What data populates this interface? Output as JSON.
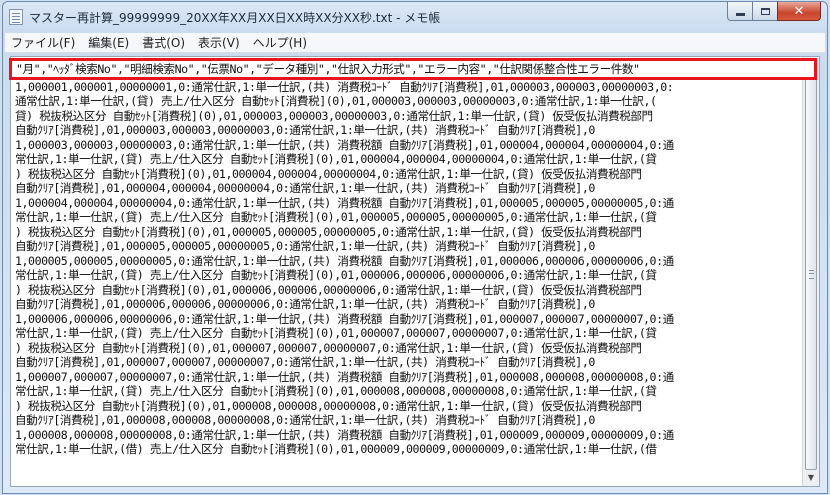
{
  "window": {
    "title": "マスター再計算_99999999_20XX年XX月XX日XX時XX分XX秒.txt - メモ帳",
    "icon": "notepad-icon",
    "buttons": {
      "minimize": "minimize-icon",
      "maximize": "maximize-icon",
      "close": "✕"
    }
  },
  "menu": {
    "items": [
      {
        "label": "ファイル(F)"
      },
      {
        "label": "編集(E)"
      },
      {
        "label": "書式(O)"
      },
      {
        "label": "表示(V)"
      },
      {
        "label": "ヘルプ(H)"
      }
    ]
  },
  "editor": {
    "header_line": "\"月\",\"ﾍｯﾀﾞ検索No\",\"明細検索No\",\"伝票No\",\"データ種別\",\"仕訳入力形式\",\"エラー内容\",\"仕訳関係整合性エラー件数\"",
    "lines": [
      "1,000001,000001,00000001,0:通常仕訳,1:単一仕訳,(貸) 売上/仕入区分 自動ｾｯﾄ[消費税](0),0",
      "1,000001,000001,00000001,0:通常仕訳,1:単一仕訳,(共) 消費税ｺｰﾄﾞ 自動ｸﾘｱ[消費税],01,000003,000003,00000003,0:",
      "通常仕訳,1:単一仕訳,(貸) 売上/仕入区分 自動ｾｯﾄ[消費税](0),01,000003,000003,00000003,0:通常仕訳,1:単一仕訳,(",
      "貸) 税抜税込区分 自動ｾｯﾄ[消費税](0),01,000003,000003,00000003,0:通常仕訳,1:単一仕訳,(貸) 仮受仮払消費税部門",
      "自動ｸﾘｱ[消費税],01,000003,000003,00000003,0:通常仕訳,1:単一仕訳,(共) 消費税ｺｰﾄﾞ 自動ｸﾘｱ[消費税],0",
      "1,000003,000003,00000003,0:通常仕訳,1:単一仕訳,(共) 消費税額 自動ｸﾘｱ[消費税],01,000004,000004,00000004,0:通",
      "常仕訳,1:単一仕訳,(貸) 売上/仕入区分 自動ｾｯﾄ[消費税](0),01,000004,000004,00000004,0:通常仕訳,1:単一仕訳,(貸",
      ") 税抜税込区分 自動ｾｯﾄ[消費税](0),01,000004,000004,00000004,0:通常仕訳,1:単一仕訳,(貸) 仮受仮払消費税部門",
      "自動ｸﾘｱ[消費税],01,000004,000004,00000004,0:通常仕訳,1:単一仕訳,(共) 消費税ｺｰﾄﾞ 自動ｸﾘｱ[消費税],0",
      "1,000004,000004,00000004,0:通常仕訳,1:単一仕訳,(共) 消費税額 自動ｸﾘｱ[消費税],01,000005,000005,00000005,0:通",
      "常仕訳,1:単一仕訳,(貸) 売上/仕入区分 自動ｾｯﾄ[消費税](0),01,000005,000005,00000005,0:通常仕訳,1:単一仕訳,(貸",
      ") 税抜税込区分 自動ｾｯﾄ[消費税](0),01,000005,000005,00000005,0:通常仕訳,1:単一仕訳,(貸) 仮受仮払消費税部門",
      "自動ｸﾘｱ[消費税],01,000005,000005,00000005,0:通常仕訳,1:単一仕訳,(共) 消費税ｺｰﾄﾞ 自動ｸﾘｱ[消費税],0",
      "1,000005,000005,00000005,0:通常仕訳,1:単一仕訳,(共) 消費税額 自動ｸﾘｱ[消費税],01,000006,000006,00000006,0:通",
      "常仕訳,1:単一仕訳,(貸) 売上/仕入区分 自動ｾｯﾄ[消費税](0),01,000006,000006,00000006,0:通常仕訳,1:単一仕訳,(貸",
      ") 税抜税込区分 自動ｾｯﾄ[消費税](0),01,000006,000006,00000006,0:通常仕訳,1:単一仕訳,(貸) 仮受仮払消費税部門",
      "自動ｸﾘｱ[消費税],01,000006,000006,00000006,0:通常仕訳,1:単一仕訳,(共) 消費税ｺｰﾄﾞ 自動ｸﾘｱ[消費税],0",
      "1,000006,000006,00000006,0:通常仕訳,1:単一仕訳,(共) 消費税額 自動ｸﾘｱ[消費税],01,000007,000007,00000007,0:通",
      "常仕訳,1:単一仕訳,(貸) 売上/仕入区分 自動ｾｯﾄ[消費税](0),01,000007,000007,00000007,0:通常仕訳,1:単一仕訳,(貸",
      ") 税抜税込区分 自動ｾｯﾄ[消費税](0),01,000007,000007,00000007,0:通常仕訳,1:単一仕訳,(貸) 仮受仮払消費税部門",
      "自動ｸﾘｱ[消費税],01,000007,000007,00000007,0:通常仕訳,1:単一仕訳,(共) 消費税ｺｰﾄﾞ 自動ｸﾘｱ[消費税],0",
      "1,000007,000007,00000007,0:通常仕訳,1:単一仕訳,(共) 消費税額 自動ｸﾘｱ[消費税],01,000008,000008,00000008,0:通",
      "常仕訳,1:単一仕訳,(貸) 売上/仕入区分 自動ｾｯﾄ[消費税](0),01,000008,000008,00000008,0:通常仕訳,1:単一仕訳,(貸",
      ") 税抜税込区分 自動ｾｯﾄ[消費税](0),01,000008,000008,00000008,0:通常仕訳,1:単一仕訳,(貸) 仮受仮払消費税部門",
      "自動ｸﾘｱ[消費税],01,000008,000008,00000008,0:通常仕訳,1:単一仕訳,(共) 消費税ｺｰﾄﾞ 自動ｸﾘｱ[消費税],0",
      "1,000008,000008,00000008,0:通常仕訳,1:単一仕訳,(共) 消費税額 自動ｸﾘｱ[消費税],01,000009,000009,00000009,0:通",
      "常仕訳,1:単一仕訳,(借) 売上/仕入区分 自動ｾｯﾄ[消費税](0),01,000009,000009,00000009,0:通常仕訳,1:単一仕訳,(借"
    ],
    "highlight_color": "#e8161c"
  },
  "scrollbar": {
    "up": "▲",
    "down": "▼"
  }
}
